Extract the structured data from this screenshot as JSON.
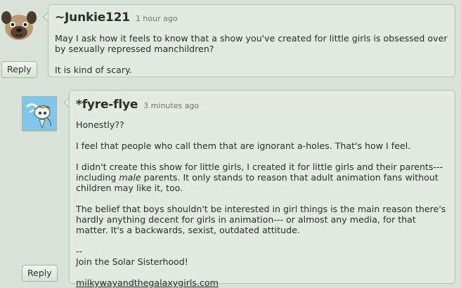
{
  "comments": [
    {
      "username": "~Junkie121",
      "timestamp": "1 hour ago",
      "paragraphs": [
        "May I ask how it feels to know that a show you've created for little girls is obsessed over by sexually repressed manchildren?",
        "It is kind of scary."
      ],
      "reply_label": "Reply"
    },
    {
      "username": "*fyre-flye",
      "timestamp": "3 minutes ago",
      "paragraphs": [
        "Honestly??",
        "I feel that people who call them that are ignorant a-holes. That's how I feel.",
        "The belief that boys shouldn't be interested in girl things is the main reason there's hardly anything decent for girls in animation--- or almost any media, for that matter. It's a backwards, sexist, outdated attitude."
      ],
      "paragraph_3_before": "I didn't create this show for little girls, I created it for little girls and their parents--- including ",
      "paragraph_3_emphasis": "male",
      "paragraph_3_after": " parents. It only stands to reason that adult animation fans without children may like it, too.",
      "signature_dashes": "--",
      "signature_text": "Join the Solar Sisterhood!",
      "signature_link": "milkywayandthegalaxygirls.com",
      "reply_label": "Reply"
    }
  ]
}
